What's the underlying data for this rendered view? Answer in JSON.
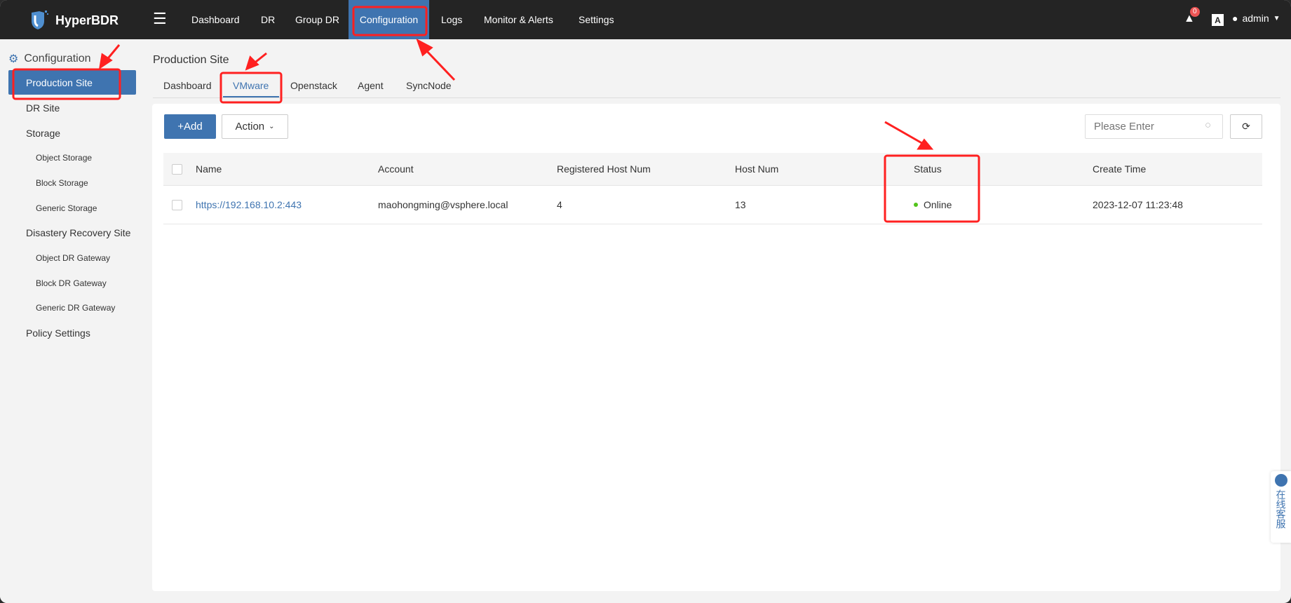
{
  "app": {
    "name": "HyperBDR"
  },
  "nav": [
    {
      "label": "Dashboard"
    },
    {
      "label": "DR"
    },
    {
      "label": "Group DR"
    },
    {
      "label": "Configuration",
      "active": true
    },
    {
      "label": "Logs"
    },
    {
      "label": "Monitor & Alerts"
    },
    {
      "label": "Settings"
    }
  ],
  "topright": {
    "alert_count": "0",
    "user": "admin"
  },
  "sidebar": {
    "title": "Configuration",
    "items": [
      {
        "label": "Production Site",
        "active": true
      },
      {
        "label": "DR Site"
      },
      {
        "label": "Storage"
      },
      {
        "label": "Object Storage"
      },
      {
        "label": "Block Storage"
      },
      {
        "label": "Generic Storage"
      },
      {
        "label": "Disastery Recovery Site"
      },
      {
        "label": "Object DR Gateway"
      },
      {
        "label": "Block DR Gateway"
      },
      {
        "label": "Generic DR Gateway"
      },
      {
        "label": "Policy Settings"
      }
    ]
  },
  "main": {
    "title": "Production Site",
    "tabs": [
      {
        "label": "Dashboard"
      },
      {
        "label": "VMware",
        "active": true
      },
      {
        "label": "Openstack"
      },
      {
        "label": "Agent"
      },
      {
        "label": "SyncNode"
      }
    ],
    "add_label": "+Add",
    "action_label": "Action",
    "search_placeholder": "Please Enter",
    "columns": [
      "Name",
      "Account",
      "Registered Host Num",
      "Host Num",
      "Status",
      "Create Time"
    ],
    "rows": [
      {
        "name": "https://192.168.10.2:443",
        "account": "maohongming@vsphere.local",
        "registered": "4",
        "hosts": "13",
        "status": "Online",
        "created": "2023-12-07 11:23:48"
      }
    ]
  },
  "chat": {
    "label": "在线客服"
  },
  "colors": {
    "accent": "#3f74b0",
    "online": "#52c41a",
    "annotation": "#ff2020"
  }
}
